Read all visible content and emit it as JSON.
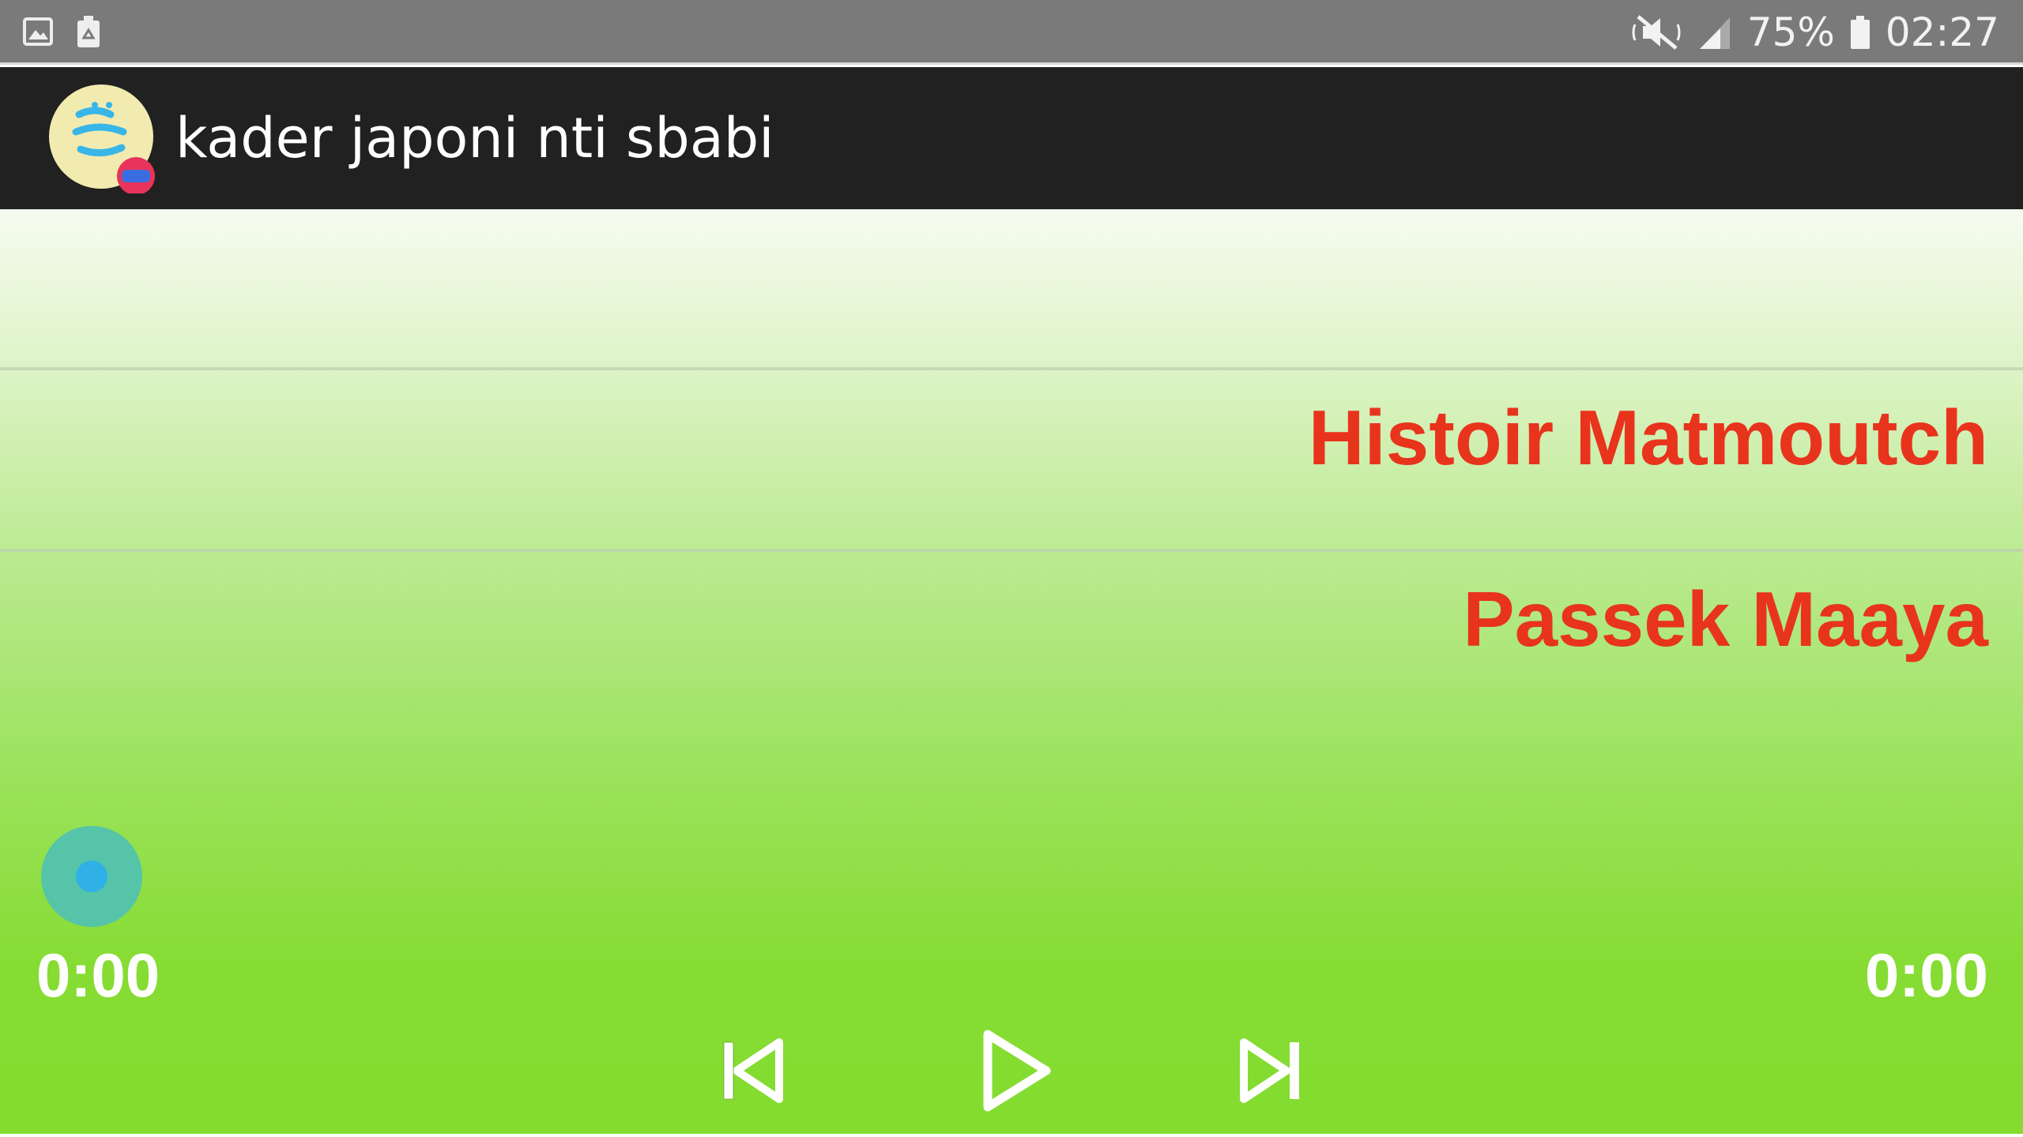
{
  "status_bar": {
    "left_icons": [
      "image-notification-icon",
      "recycle-notification-icon"
    ],
    "right_icons": [
      "mute-icon",
      "signal-icon",
      "battery-icon"
    ],
    "battery": "75%",
    "time": "02:27"
  },
  "action_bar": {
    "logo_icon": "app-logo-icon",
    "title": "kader japoni nti sbabi"
  },
  "playlist": {
    "items": [
      {
        "label": ""
      },
      {
        "label": "Histoir Matmoutch"
      },
      {
        "label": "Passek Maaya"
      }
    ]
  },
  "player": {
    "elapsed": "0:00",
    "duration": "0:00",
    "progress": 0,
    "controls": [
      "previous-icon",
      "play-icon",
      "next-icon"
    ]
  },
  "colors": {
    "status_bar_bg": "#7a7a7a",
    "action_bar_bg": "#212121",
    "song_text": "#e8341c",
    "gradient_top": "#f6fbf0",
    "gradient_bottom": "#84dc30",
    "seek_thumb": "#55c4a8",
    "seek_core": "#2fb0e6"
  }
}
